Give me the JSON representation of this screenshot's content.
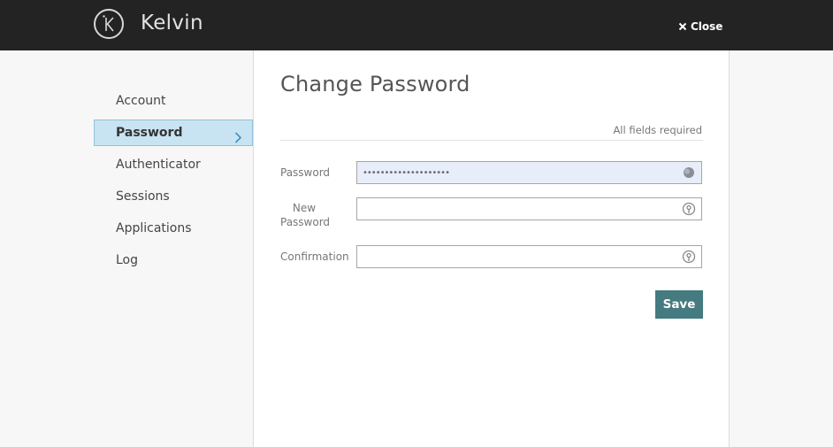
{
  "header": {
    "brand": "Kelvin",
    "logo_letter": "K",
    "close_label": "Close"
  },
  "sidebar": {
    "items": [
      {
        "label": "Account",
        "active": false
      },
      {
        "label": "Password",
        "active": true
      },
      {
        "label": "Authenticator",
        "active": false
      },
      {
        "label": "Sessions",
        "active": false
      },
      {
        "label": "Applications",
        "active": false
      },
      {
        "label": "Log",
        "active": false
      }
    ]
  },
  "main": {
    "title": "Change Password",
    "required_note": "All fields required",
    "fields": {
      "password": {
        "label": "Password",
        "value": "••••••••••••••••••••"
      },
      "new_password": {
        "label_line1": "New",
        "label_line2": "Password",
        "value": ""
      },
      "confirmation": {
        "label": "Confirmation",
        "value": ""
      }
    },
    "save_label": "Save"
  },
  "colors": {
    "header_bg": "#232323",
    "active_bg": "#c8e3f1",
    "save_bg": "#457a80"
  },
  "icons": {
    "close": "close-icon",
    "chevron": "chevron-right-icon",
    "password_manager": "password-manager-icon"
  }
}
